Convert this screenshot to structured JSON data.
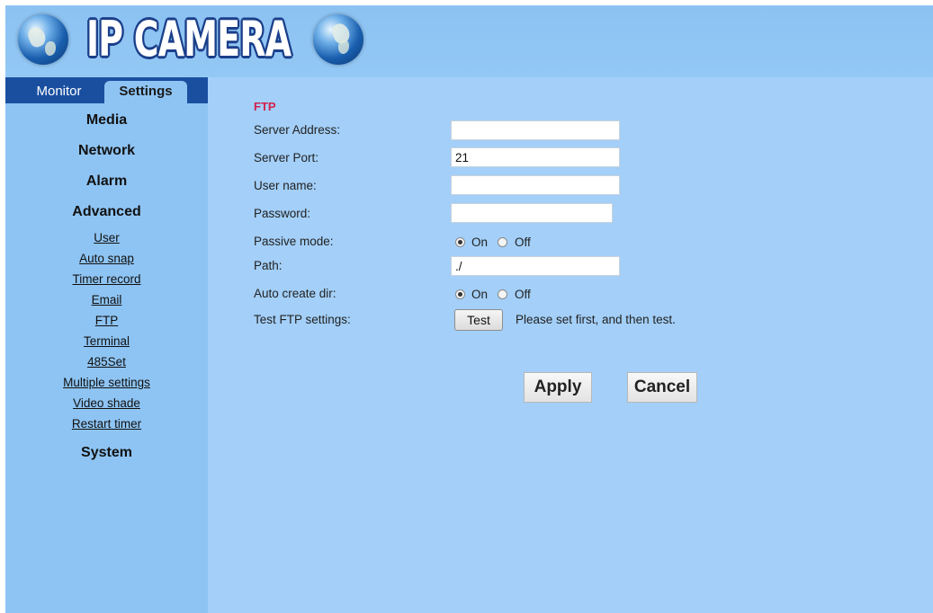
{
  "header": {
    "title": "IP CAMERA",
    "left_icon": "globe-icon",
    "right_icon": "globe-icon"
  },
  "tabs": {
    "monitor": "Monitor",
    "settings": "Settings"
  },
  "sidebar": {
    "sections": {
      "media": "Media",
      "network": "Network",
      "alarm": "Alarm",
      "advanced": "Advanced",
      "system": "System"
    },
    "advanced_items": [
      "User",
      "Auto snap",
      "Timer record",
      "Email",
      "FTP",
      "Terminal",
      "485Set",
      "Multiple settings",
      "Video shade",
      "Restart timer"
    ]
  },
  "form": {
    "title": "FTP",
    "server_address": {
      "label": "Server Address:",
      "value": ""
    },
    "server_port": {
      "label": "Server Port:",
      "value": "21"
    },
    "user_name": {
      "label": "User name:",
      "value": ""
    },
    "password": {
      "label": "Password:",
      "value": ""
    },
    "passive_mode": {
      "label": "Passive mode:",
      "on": "On",
      "off": "Off",
      "selected": "On"
    },
    "path": {
      "label": "Path:",
      "value": "./"
    },
    "auto_create_dir": {
      "label": "Auto create dir:",
      "on": "On",
      "off": "Off",
      "selected": "On"
    },
    "test_ftp": {
      "label": "Test FTP settings:",
      "button": "Test",
      "hint": "Please set first, and then test."
    }
  },
  "actions": {
    "apply": "Apply",
    "cancel": "Cancel"
  },
  "colors": {
    "header_bg": "#8cc2f2",
    "sidebar_bg": "#8ec4f3",
    "main_bg": "#a3cff8",
    "tab_bar_bg": "#1a4fa0",
    "section_title": "#d2204b"
  }
}
